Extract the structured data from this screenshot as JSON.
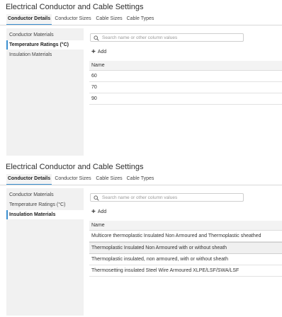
{
  "panels": [
    {
      "title": "Electrical Conductor and Cable Settings",
      "tabs": [
        "Conductor Details",
        "Conductor Sizes",
        "Cable Sizes",
        "Cable Types"
      ],
      "sidebar": [
        "Conductor Materials",
        "Temperature Ratings (°C)",
        "Insulation Materials"
      ],
      "search_placeholder": "Search name or other column values",
      "add_label": "Add",
      "column": "Name",
      "rows": [
        "60",
        "70",
        "90"
      ]
    },
    {
      "title": "Electrical Conductor and Cable Settings",
      "tabs": [
        "Conductor Details",
        "Conductor Sizes",
        "Cable Sizes",
        "Cable Types"
      ],
      "sidebar": [
        "Conductor Materials",
        "Temperature Ratings (°C)",
        "Insulation Materials"
      ],
      "search_placeholder": "Search name or other column values",
      "add_label": "Add",
      "column": "Name",
      "rows": [
        "Multicore thermoplastic Insulated Non Armoured and Thermoplastic sheathed",
        "Thermoplastic Insulated Non Armoured with or without sheath",
        "Thermoplastic insulated, non armoured, with or without sheath",
        "Thermosetting insulated Steel Wire Armoured XLPE/LSF/SWA/LSF"
      ]
    }
  ]
}
